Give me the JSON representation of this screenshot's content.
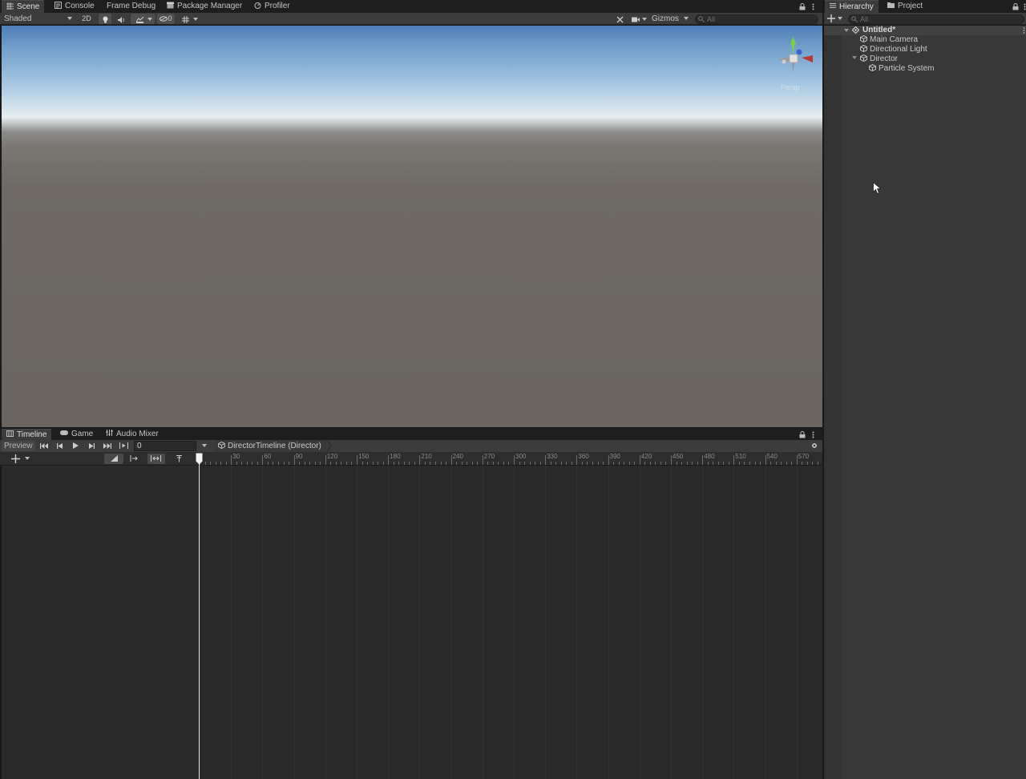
{
  "scene_panel": {
    "tabs": [
      {
        "label": "Scene",
        "icon": "grid-icon"
      },
      {
        "label": "Console",
        "icon": "console-icon"
      },
      {
        "label": "Frame Debug",
        "icon": ""
      },
      {
        "label": "Package Manager",
        "icon": "package-icon"
      },
      {
        "label": "Profiler",
        "icon": "profiler-icon"
      }
    ],
    "toolbar": {
      "draw_mode": "Shaded",
      "mode_2d": "2D",
      "hidden_count": "0",
      "gizmos_label": "Gizmos",
      "search_placeholder": "All"
    },
    "gizmo_projection": "Persp"
  },
  "timeline_panel": {
    "tabs": [
      {
        "label": "Timeline",
        "icon": "timeline-icon"
      },
      {
        "label": "Game",
        "icon": "gamepad-icon"
      },
      {
        "label": "Audio Mixer",
        "icon": "mixer-icon"
      }
    ],
    "preview_label": "Preview",
    "frame_value": "0",
    "breadcrumb": "DirectorTimeline (Director)",
    "ruler_labels": [
      "30",
      "60",
      "90",
      "120",
      "150",
      "180",
      "210",
      "240",
      "270",
      "300",
      "330",
      "360",
      "390",
      "420",
      "450",
      "480",
      "510",
      "540",
      "570"
    ]
  },
  "hierarchy_panel": {
    "tabs": [
      {
        "label": "Hierarchy",
        "icon": "list-icon"
      },
      {
        "label": "Project",
        "icon": "folder-icon"
      }
    ],
    "search_placeholder": "All",
    "scene_name": "Untitled*",
    "items": [
      {
        "label": "Main Camera",
        "depth": 1,
        "expandable": false
      },
      {
        "label": "Directional Light",
        "depth": 1,
        "expandable": false
      },
      {
        "label": "Director",
        "depth": 1,
        "expandable": true
      },
      {
        "label": "Particle System",
        "depth": 2,
        "expandable": false
      }
    ]
  }
}
